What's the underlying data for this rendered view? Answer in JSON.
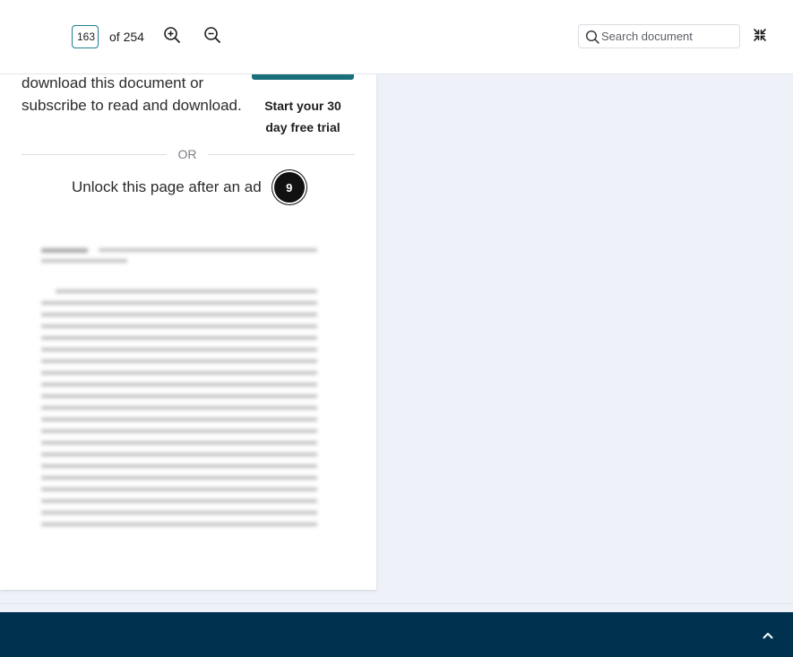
{
  "toolbar": {
    "page_input_value": "163",
    "page_total_text": "of 254",
    "search_placeholder": "Search document",
    "zoom_in_icon": "zoom-in-icon",
    "zoom_out_icon": "zoom-out-icon",
    "collapse_icon": "collapse-icon",
    "accent_color": "#1a7f8e"
  },
  "paywall": {
    "download_text": "download this document or subscribe to read and download.",
    "trial_text": "Start your 30 day free trial",
    "or_text": "OR",
    "unlock_text": "Unlock this page after an ad",
    "ad_countdown": "9",
    "cta_color": "#1a6f7a"
  },
  "footer": {
    "background_color": "#00324f",
    "scroll_top_icon": "chevron-up-icon"
  }
}
